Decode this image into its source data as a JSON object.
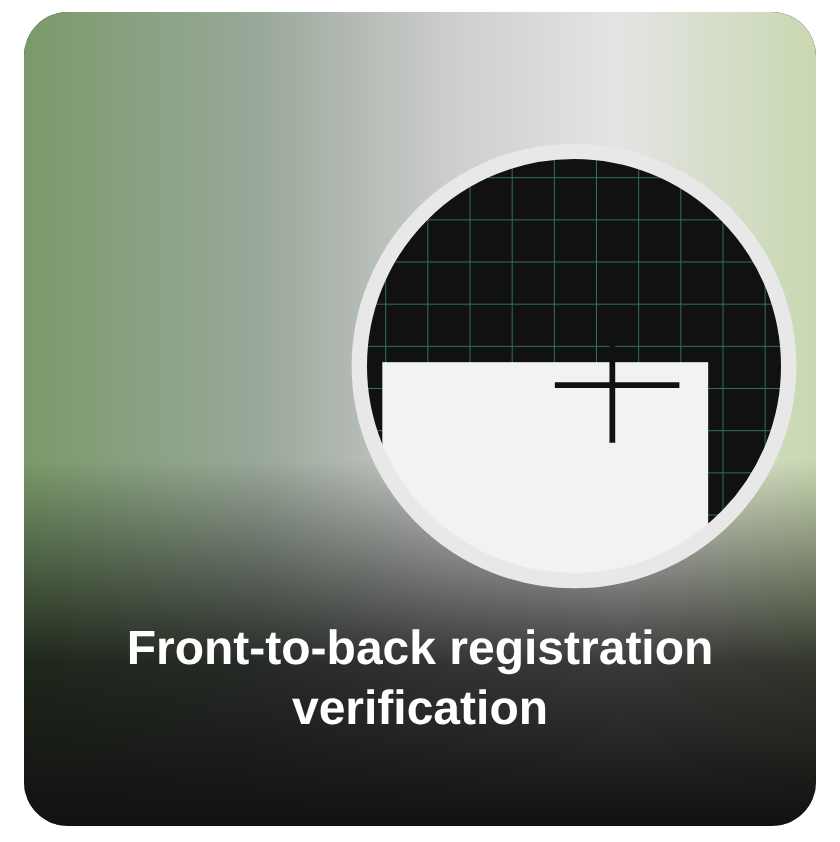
{
  "card": {
    "caption": "Front-to-back registration verification"
  }
}
